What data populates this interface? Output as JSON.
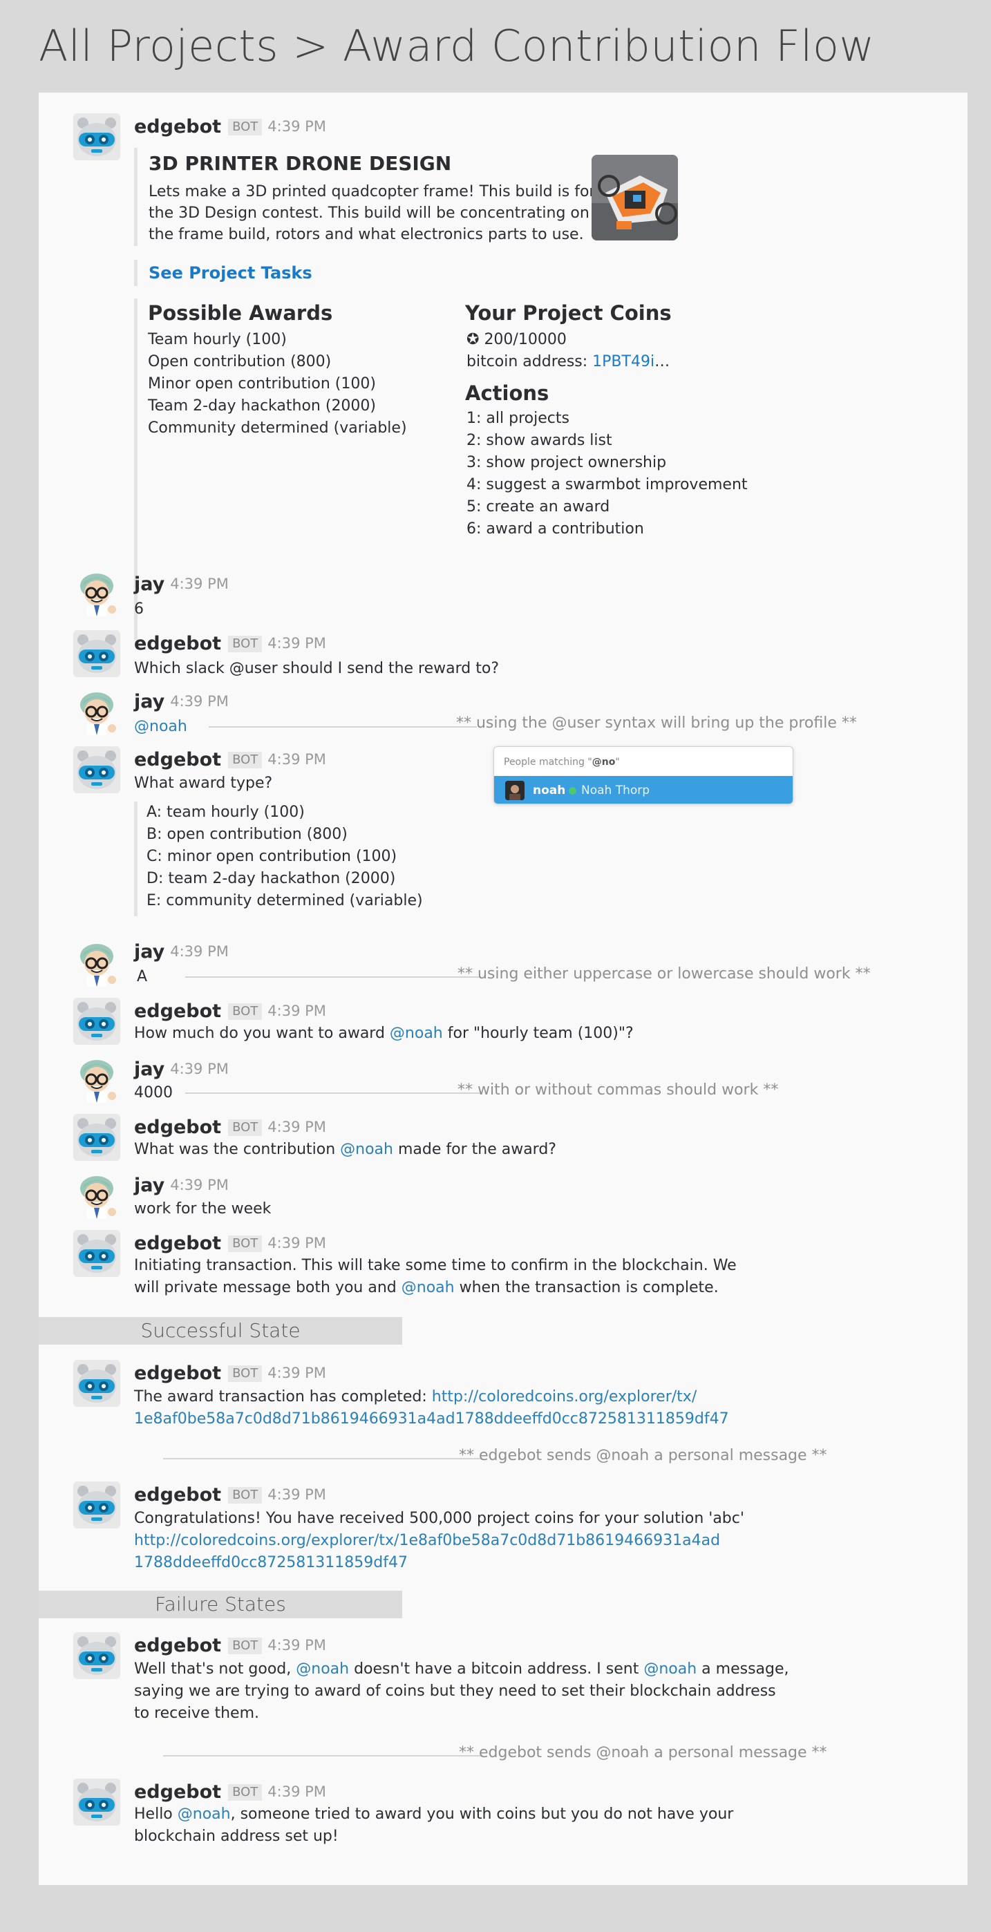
{
  "page_title": "All Projects > Award Contribution Flow",
  "bot_name": "edgebot",
  "bot_badge": "BOT",
  "user_name": "jay",
  "time": "4:39 PM",
  "project": {
    "title": "3D PRINTER DRONE DESIGN",
    "description": [
      "Lets make a 3D printed quadcopter frame! This build is for",
      "the 3D Design contest. This build will be concentrating on",
      "the frame build, rotors and what electronics parts to use."
    ],
    "tasks_link": "See Project Tasks",
    "awards_title": "Possible Awards",
    "awards": [
      "Team hourly (100)",
      "Open contribution (800)",
      "Minor open contribution (100)",
      "Team 2-day hackathon (2000)",
      "Community determined (variable)"
    ],
    "coins_title": "Your Project Coins",
    "coins_value": "200/10000",
    "bitcoin_label": "bitcoin address:",
    "bitcoin_address": "1PBT49i",
    "bitcoin_ellipsis": "…",
    "actions_title": "Actions",
    "actions": [
      "1: all projects",
      "2: show awards list",
      "3: show project ownership",
      "4: suggest a swarmbot improvement",
      "5: create an award",
      "6: award a contribution"
    ]
  },
  "messages": {
    "jay_1": "6",
    "bot_2": "Which slack @user should I send the reward to?",
    "jay_2": "@noah",
    "note_1": "** using the @user syntax will bring up the profile **",
    "bot_3": "What award type?",
    "award_options": [
      "A: team hourly (100)",
      "B: open contribution (800)",
      "C: minor open contribution (100)",
      "D: team 2-day hackathon (2000)",
      "E: community determined (variable)"
    ],
    "jay_3": "A",
    "note_2": "** using either uppercase or lowercase should work **",
    "bot_4_a": "How much do you want to award ",
    "bot_4_mention": "@noah",
    "bot_4_b": " for \"hourly team (100)\"?",
    "jay_4": "4000",
    "note_3": "** with or without commas should work **",
    "bot_5_a": "What was the contribution ",
    "bot_5_mention": "@noah",
    "bot_5_b": " made for the award?",
    "jay_5": "work for the week",
    "bot_6_line1": "Initiating transaction. This will take some time to confirm in the blockchain. We",
    "bot_6_line2_a": "will private message both you and ",
    "bot_6_mention": "@noah",
    "bot_6_line2_b": " when the transaction is complete."
  },
  "popup": {
    "header_a": "People matching \"",
    "header_b": "@no",
    "header_c": "\"",
    "name": "noah",
    "full_name": "Noah Thorp"
  },
  "success": {
    "section": "Successful State",
    "msg1_a": "The award transaction has completed: ",
    "msg1_link1": "http://coloredcoins.org/explorer/tx/",
    "msg1_link2": "1e8af0be58a7c0d8d71b8619466931a4ad1788ddeeffd0cc872581311859df47",
    "note": "** edgebot sends @noah a personal message **",
    "msg2_a": "Congratulations! You have received 500,000 project coins for your solution 'abc'",
    "msg2_link1": "http://coloredcoins.org/explorer/tx/1e8af0be58a7c0d8d71b8619466931a4ad",
    "msg2_link2": "1788ddeeffd0cc872581311859df47"
  },
  "failure": {
    "section": "Failure States",
    "msg1_a": "Well that's not good, ",
    "msg1_m1": "@noah",
    "msg1_b": " doesn't have a bitcoin address. I sent ",
    "msg1_m2": "@noah",
    "msg1_c": " a message,",
    "msg1_line2": "saying we are trying to award of coins but they need to set their blockchain address",
    "msg1_line3": "to receive them.",
    "note": "** edgebot sends @noah a personal message **",
    "msg2_a": "Hello ",
    "msg2_m": "@noah",
    "msg2_b": ", someone tried to award you with coins but you do not have your",
    "msg2_line2": "blockchain address set up!"
  },
  "colors": {
    "link": "#2a80b9",
    "accent_blue": "#1b7ac8",
    "popup_highlight": "#3a9fe0"
  }
}
